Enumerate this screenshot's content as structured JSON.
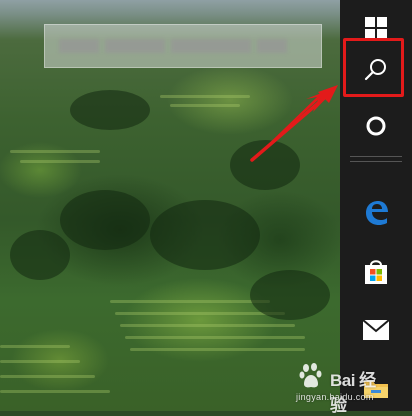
{
  "taskbar": {
    "items": [
      {
        "name": "windows-start",
        "icon": "windows-logo-icon"
      },
      {
        "name": "search",
        "icon": "search-icon"
      },
      {
        "name": "cortana",
        "icon": "cortana-ring-icon"
      },
      {
        "name": "edge",
        "icon": "edge-browser-icon"
      },
      {
        "name": "store",
        "icon": "store-bag-icon"
      },
      {
        "name": "mail",
        "icon": "mail-envelope-icon"
      },
      {
        "name": "file-explorer",
        "icon": "folder-icon"
      }
    ],
    "background": "#1c1c1c"
  },
  "annotation": {
    "highlight_color": "#e31a1a"
  },
  "watermark": {
    "brand": "Bai 经验",
    "url": "jingyan.baidu.com"
  },
  "colors": {
    "edge_blue": "#1e7ad4",
    "store_red": "#f25022",
    "store_green": "#7fba00",
    "store_blue": "#00a4ef",
    "store_yellow": "#ffb900"
  }
}
